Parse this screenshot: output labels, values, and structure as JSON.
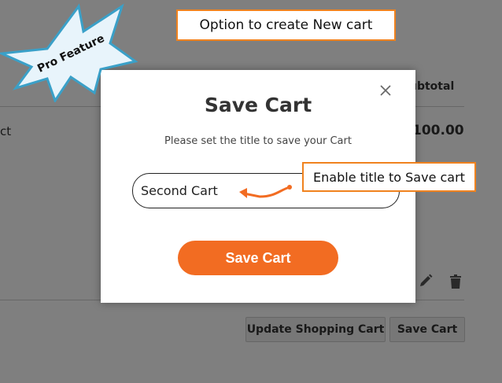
{
  "background": {
    "col_subtotal": "ubtotal",
    "product_partial": "ct",
    "price": "100.00",
    "update_button": "Update Shopping Cart",
    "save_button": "Save Cart"
  },
  "modal": {
    "title": "Save Cart",
    "subtitle": "Please set the title to save your Cart",
    "input_value": "Second Cart",
    "save_button": "Save Cart"
  },
  "annotations": {
    "top_callout": "Option to create New cart",
    "right_callout": "Enable title to Save cart",
    "burst_label": "Pro Feature"
  },
  "colors": {
    "accent": "#f26c22",
    "callout_border": "#f0821e",
    "burst_fill": "#e8f4fb",
    "burst_stroke": "#3aa0c8"
  },
  "icons": {
    "close": "close-icon",
    "edit": "pencil-icon",
    "delete": "trash-icon"
  }
}
